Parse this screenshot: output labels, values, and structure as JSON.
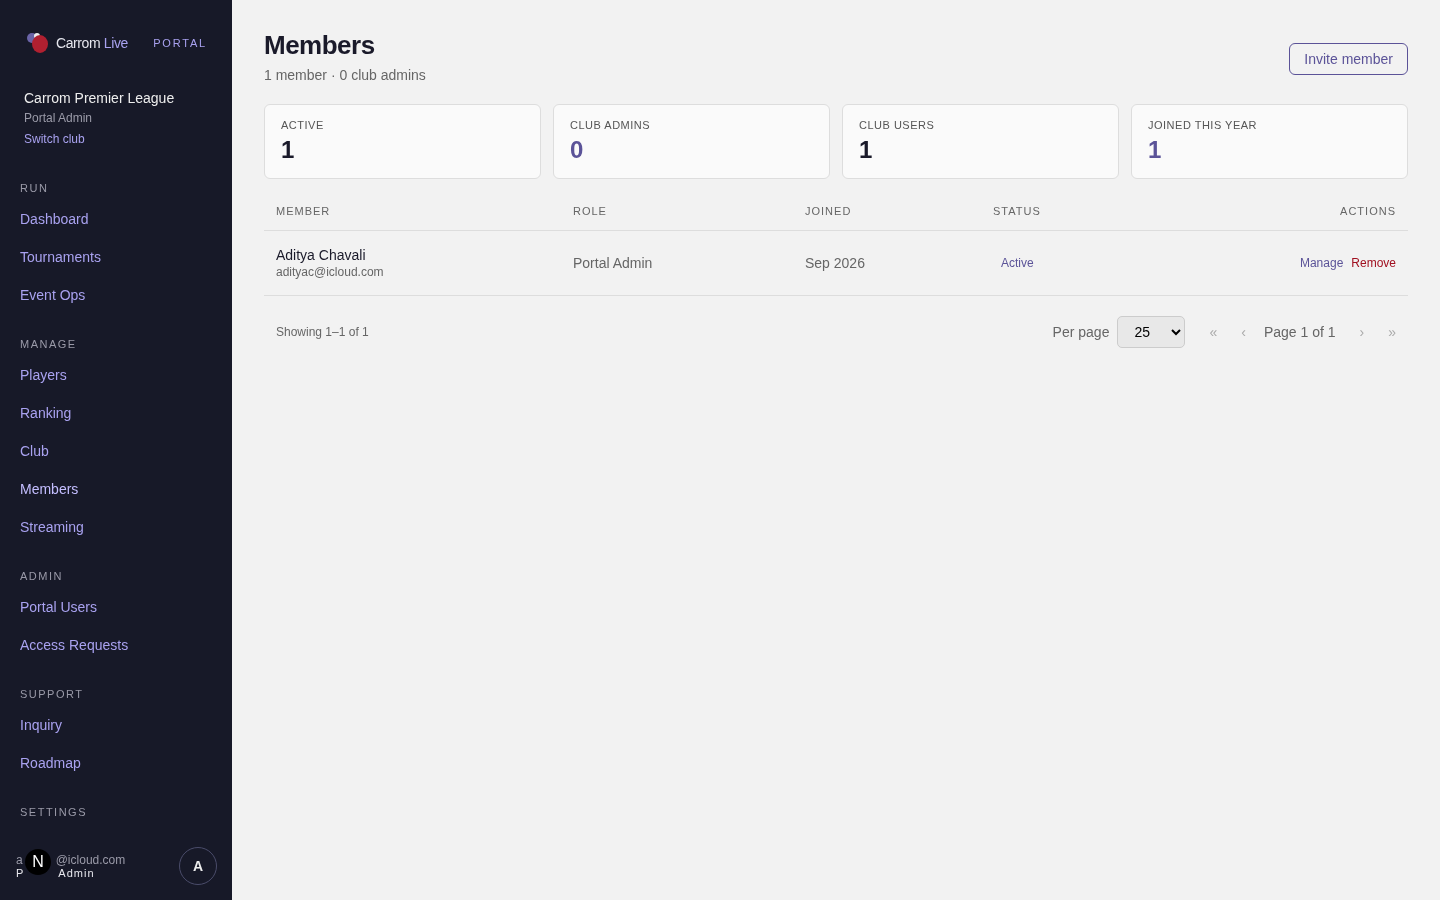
{
  "sidebar": {
    "brand": {
      "name": "Carrom",
      "accent": "Live",
      "tag": "PORTAL"
    },
    "club": {
      "name": "Carrom Premier League",
      "role": "Portal Admin",
      "switch": "Switch club"
    },
    "sections": [
      {
        "title": "RUN",
        "items": [
          {
            "label": "Dashboard",
            "selected": false
          },
          {
            "label": "Tournaments",
            "selected": false
          },
          {
            "label": "Event Ops",
            "selected": false
          }
        ]
      },
      {
        "title": "MANAGE",
        "items": [
          {
            "label": "Players",
            "selected": false
          },
          {
            "label": "Ranking",
            "selected": false
          },
          {
            "label": "Club",
            "selected": false
          },
          {
            "label": "Members",
            "selected": true
          },
          {
            "label": "Streaming",
            "selected": false
          }
        ]
      },
      {
        "title": "ADMIN",
        "items": [
          {
            "label": "Portal Users",
            "selected": false
          },
          {
            "label": "Access Requests",
            "selected": false
          }
        ]
      },
      {
        "title": "SUPPORT",
        "items": [
          {
            "label": "Inquiry",
            "selected": false
          },
          {
            "label": "Roadmap",
            "selected": false
          }
        ]
      },
      {
        "title": "SETTINGS"
      }
    ],
    "user": {
      "email_parts": [
        "a",
        "@icloud.com"
      ],
      "role_parts": [
        "P",
        "Admin"
      ],
      "badge": "N",
      "avatar": "A"
    }
  },
  "header": {
    "title": "Members",
    "subtitle": "1 member · 0 club admins",
    "invite": "Invite member"
  },
  "stats": [
    {
      "label": "ACTIVE",
      "value": "1",
      "accent": false
    },
    {
      "label": "CLUB ADMINS",
      "value": "0",
      "accent": true
    },
    {
      "label": "CLUB USERS",
      "value": "1",
      "accent": false
    },
    {
      "label": "JOINED THIS YEAR",
      "value": "1",
      "accent": true
    }
  ],
  "table": {
    "columns": [
      "MEMBER",
      "ROLE",
      "JOINED",
      "STATUS",
      "ACTIONS"
    ],
    "rows": [
      {
        "name": "Aditya Chavali",
        "email": "adityac@icloud.com",
        "role": "Portal Admin",
        "joined": "Sep 2026",
        "status": "Active",
        "actions": [
          "Manage",
          "Remove"
        ]
      }
    ]
  },
  "pagination": {
    "showing": "Showing 1–1 of 1",
    "per_page_label": "Per page",
    "per_page": "25",
    "first": "«",
    "prev": "‹",
    "page": "Page 1 of 1",
    "next": "›",
    "last": "»"
  }
}
